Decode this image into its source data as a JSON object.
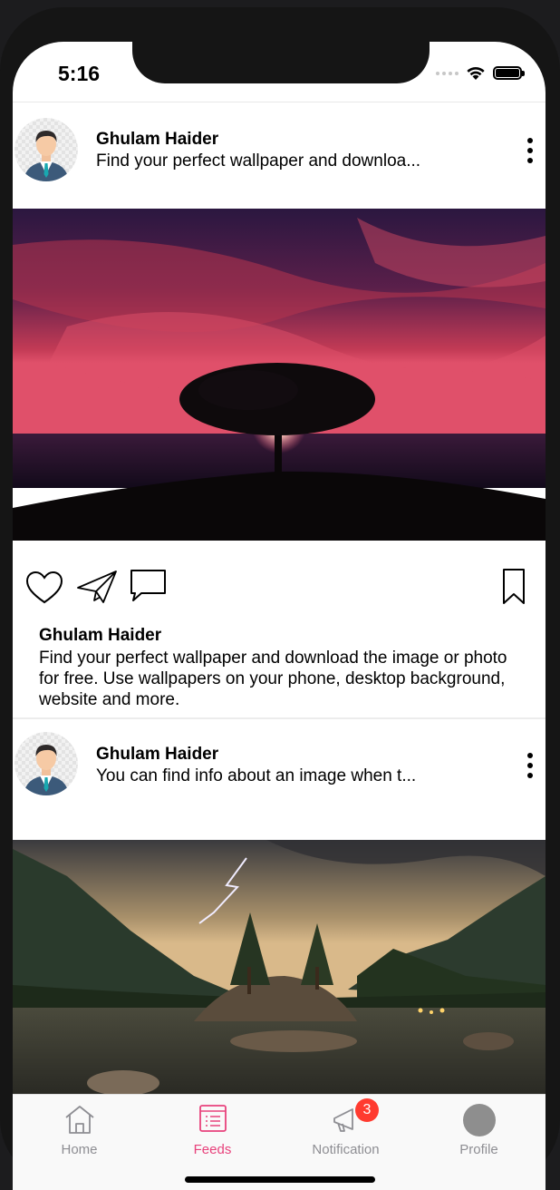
{
  "status_bar": {
    "time": "5:16"
  },
  "posts": [
    {
      "author": "Ghulam Haider",
      "subtitle": "Find your perfect wallpaper and downloa...",
      "image_description": "sunset tree",
      "caption_author": "Ghulam Haider",
      "caption": "Find your perfect wallpaper and download the image or photo for free. Use wallpapers on your phone, desktop background, website and more."
    },
    {
      "author": "Ghulam Haider",
      "subtitle": "You can find info about an image when t...",
      "image_description": "mountain lake"
    }
  ],
  "tabbar": {
    "tabs": [
      {
        "label": "Home",
        "icon": "home-icon"
      },
      {
        "label": "Feeds",
        "icon": "list-icon",
        "active": true
      },
      {
        "label": "Notification",
        "icon": "megaphone-icon",
        "badge": "3"
      },
      {
        "label": "Profile",
        "icon": "profile-avatar-icon"
      }
    ]
  },
  "colors": {
    "accent": "#e8427c",
    "badge": "#ff3b30",
    "inactive": "#8e8e93"
  }
}
